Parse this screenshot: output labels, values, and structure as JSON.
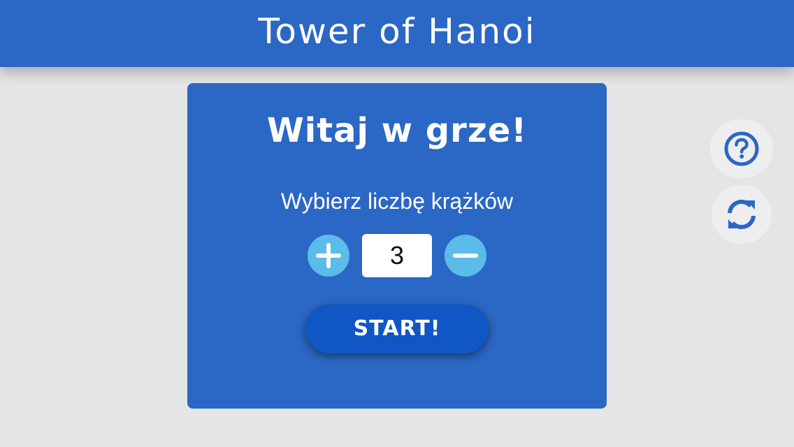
{
  "header": {
    "title": "Tower of Hanoi"
  },
  "panel": {
    "welcome": "Witaj w grze!",
    "choose_label": "Wybierz liczbę krążków",
    "disk_count": "3",
    "start_label": "START!"
  },
  "icons": {
    "increase": "plus-icon",
    "decrease": "minus-icon",
    "help": "question-circle-icon",
    "reset": "refresh-icon"
  },
  "colors": {
    "brand_blue": "#2b67c4",
    "start_button": "#1056c4",
    "stepper_button": "#5bbce9",
    "background": "#e5e5e5",
    "side_button": "#eeeeee"
  }
}
